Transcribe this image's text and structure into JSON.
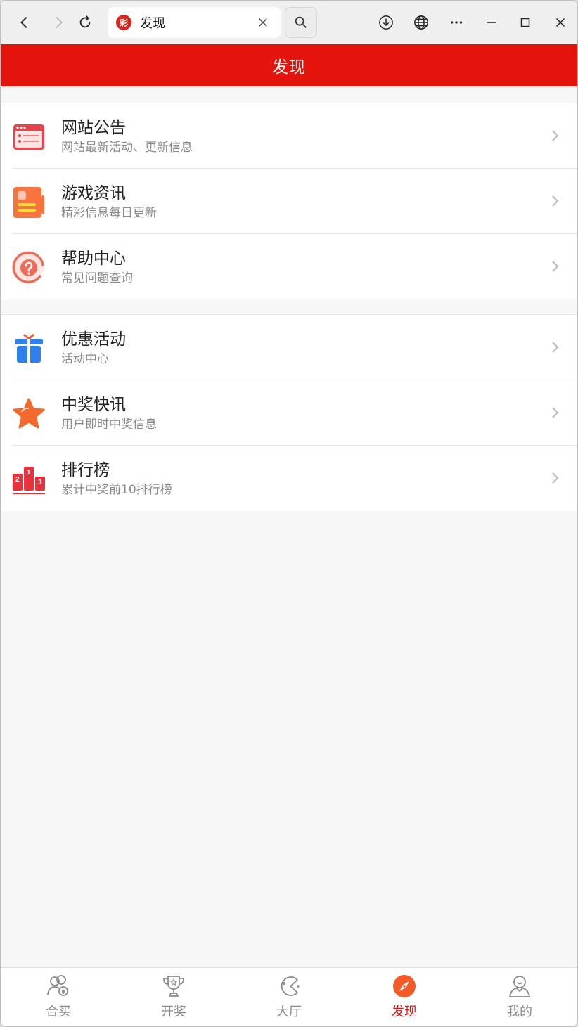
{
  "browser": {
    "tab_title": "发现",
    "favicon_char": "彩"
  },
  "header": {
    "title": "发现"
  },
  "groups": [
    {
      "items": [
        {
          "title": "网站公告",
          "subtitle": "网站最新活动、更新信息",
          "icon": "announcement-icon"
        },
        {
          "title": "游戏资讯",
          "subtitle": "精彩信息每日更新",
          "icon": "news-icon"
        },
        {
          "title": "帮助中心",
          "subtitle": "常见问题查询",
          "icon": "help-icon"
        }
      ]
    },
    {
      "items": [
        {
          "title": "优惠活动",
          "subtitle": "活动中心",
          "icon": "gift-icon"
        },
        {
          "title": "中奖快讯",
          "subtitle": "用户即时中奖信息",
          "icon": "star-icon"
        },
        {
          "title": "排行榜",
          "subtitle": "累计中奖前10排行榜",
          "icon": "podium-icon"
        }
      ]
    }
  ],
  "tabbar": [
    {
      "label": "合买",
      "icon": "group-buy-icon",
      "active": false
    },
    {
      "label": "开奖",
      "icon": "trophy-icon",
      "active": false
    },
    {
      "label": "大厅",
      "icon": "game-hall-icon",
      "active": false
    },
    {
      "label": "发现",
      "icon": "compass-icon",
      "active": true
    },
    {
      "label": "我的",
      "icon": "profile-icon",
      "active": false
    }
  ],
  "colors": {
    "brand_red": "#e4130b",
    "active_tab": "#e4130b",
    "inactive_tab": "#8a8a8a"
  }
}
